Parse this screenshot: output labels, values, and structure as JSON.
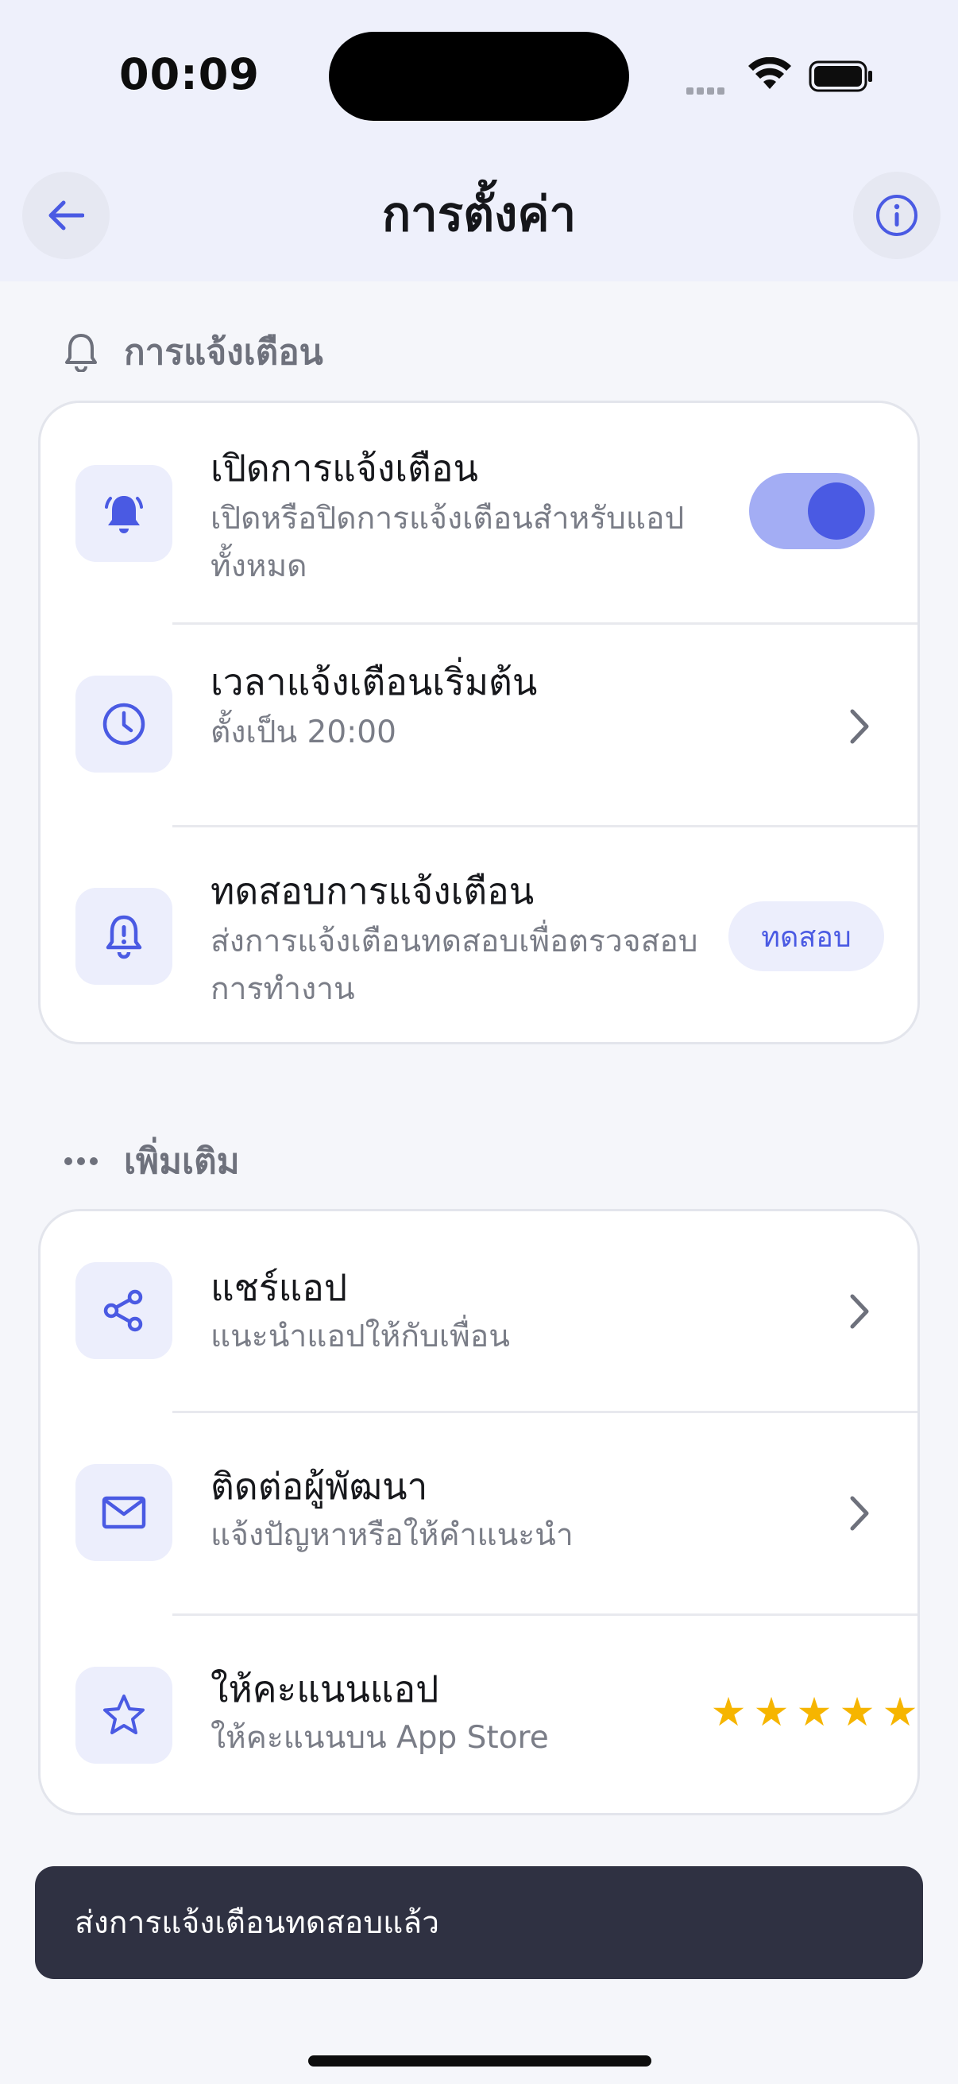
{
  "status": {
    "time": "00:09"
  },
  "header": {
    "title": "การตั้งค่า"
  },
  "sections": {
    "notifications": {
      "label": "การแจ้งเตือน",
      "rows": [
        {
          "title": "เปิดการแจ้งเตือน",
          "subtitle": "เปิดหรือปิดการแจ้งเตือนสำหรับแอปทั้งหมด",
          "toggle_on": true
        },
        {
          "title": "เวลาแจ้งเตือนเริ่มต้น",
          "subtitle": "ตั้งเป็น 20:00"
        },
        {
          "title": "ทดสอบการแจ้งเตือน",
          "subtitle": "ส่งการแจ้งเตือนทดสอบเพื่อตรวจสอบการทำงาน",
          "button": "ทดสอบ"
        }
      ]
    },
    "more": {
      "label": "เพิ่มเติม",
      "rows": [
        {
          "title": "แชร์แอป",
          "subtitle": "แนะนำแอปให้กับเพื่อน"
        },
        {
          "title": "ติดต่อผู้พัฒนา",
          "subtitle": "แจ้งปัญหาหรือให้คำแนะนำ"
        },
        {
          "title": "ให้คะแนนแอป",
          "subtitle": "ให้คะแนนบน App Store",
          "stars": 5
        }
      ]
    }
  },
  "toast": {
    "message": "ส่งการแจ้งเตือนทดสอบแล้ว"
  },
  "colors": {
    "accent": "#4a5ae3",
    "star": "#f6b500",
    "toast_bg": "#2f3142"
  }
}
